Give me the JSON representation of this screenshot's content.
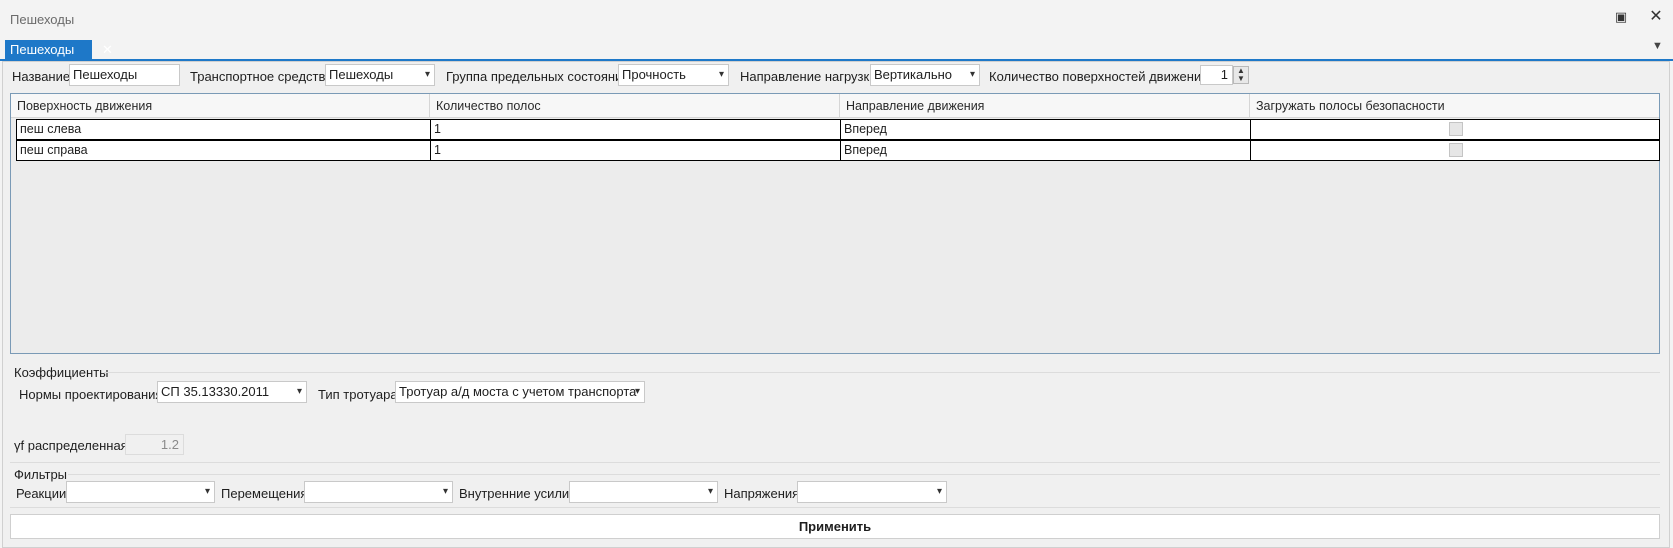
{
  "window": {
    "title": "Пешеходы"
  },
  "tab": {
    "label": "Пешеходы"
  },
  "form": {
    "name_label": "Название",
    "name_value": "Пешеходы",
    "vehicle_label": "Транспортное средство",
    "vehicle_value": "Пешеходы",
    "limit_group_label": "Группа предельных состояний",
    "limit_group_value": "Прочность",
    "load_dir_label": "Направление нагрузки",
    "load_dir_value": "Вертикально",
    "surfaces_label": "Количество поверхностей движения",
    "surfaces_value": "1"
  },
  "table": {
    "columns": [
      "Поверхность движения",
      "Количество полос",
      "Направление движения",
      "Загружать полосы безопасности"
    ],
    "rows": [
      {
        "surface": "пеш слева",
        "lanes": "1",
        "direction": "Вперед",
        "safety": false
      },
      {
        "surface": "пеш справа",
        "lanes": "1",
        "direction": "Вперед",
        "safety": false
      }
    ]
  },
  "coefficients": {
    "group_label": "Коэффициенты",
    "norms_label": "Нормы проектирования",
    "norms_value": "СП 35.13330.2011",
    "sidewalk_label": "Тип тротуара",
    "sidewalk_value": "Тротуар а/д моста с учетом транспорта",
    "gamma_label": "γf распределенная",
    "gamma_value": "1.2"
  },
  "filters": {
    "group_label": "Фильтры",
    "reactions_label": "Реакции",
    "reactions_value": "",
    "displacements_label": "Перемещения",
    "displacements_value": "",
    "internal_label": "Внутренние усилия",
    "internal_value": "",
    "stresses_label": "Напряжения",
    "stresses_value": ""
  },
  "apply_label": "Применить"
}
